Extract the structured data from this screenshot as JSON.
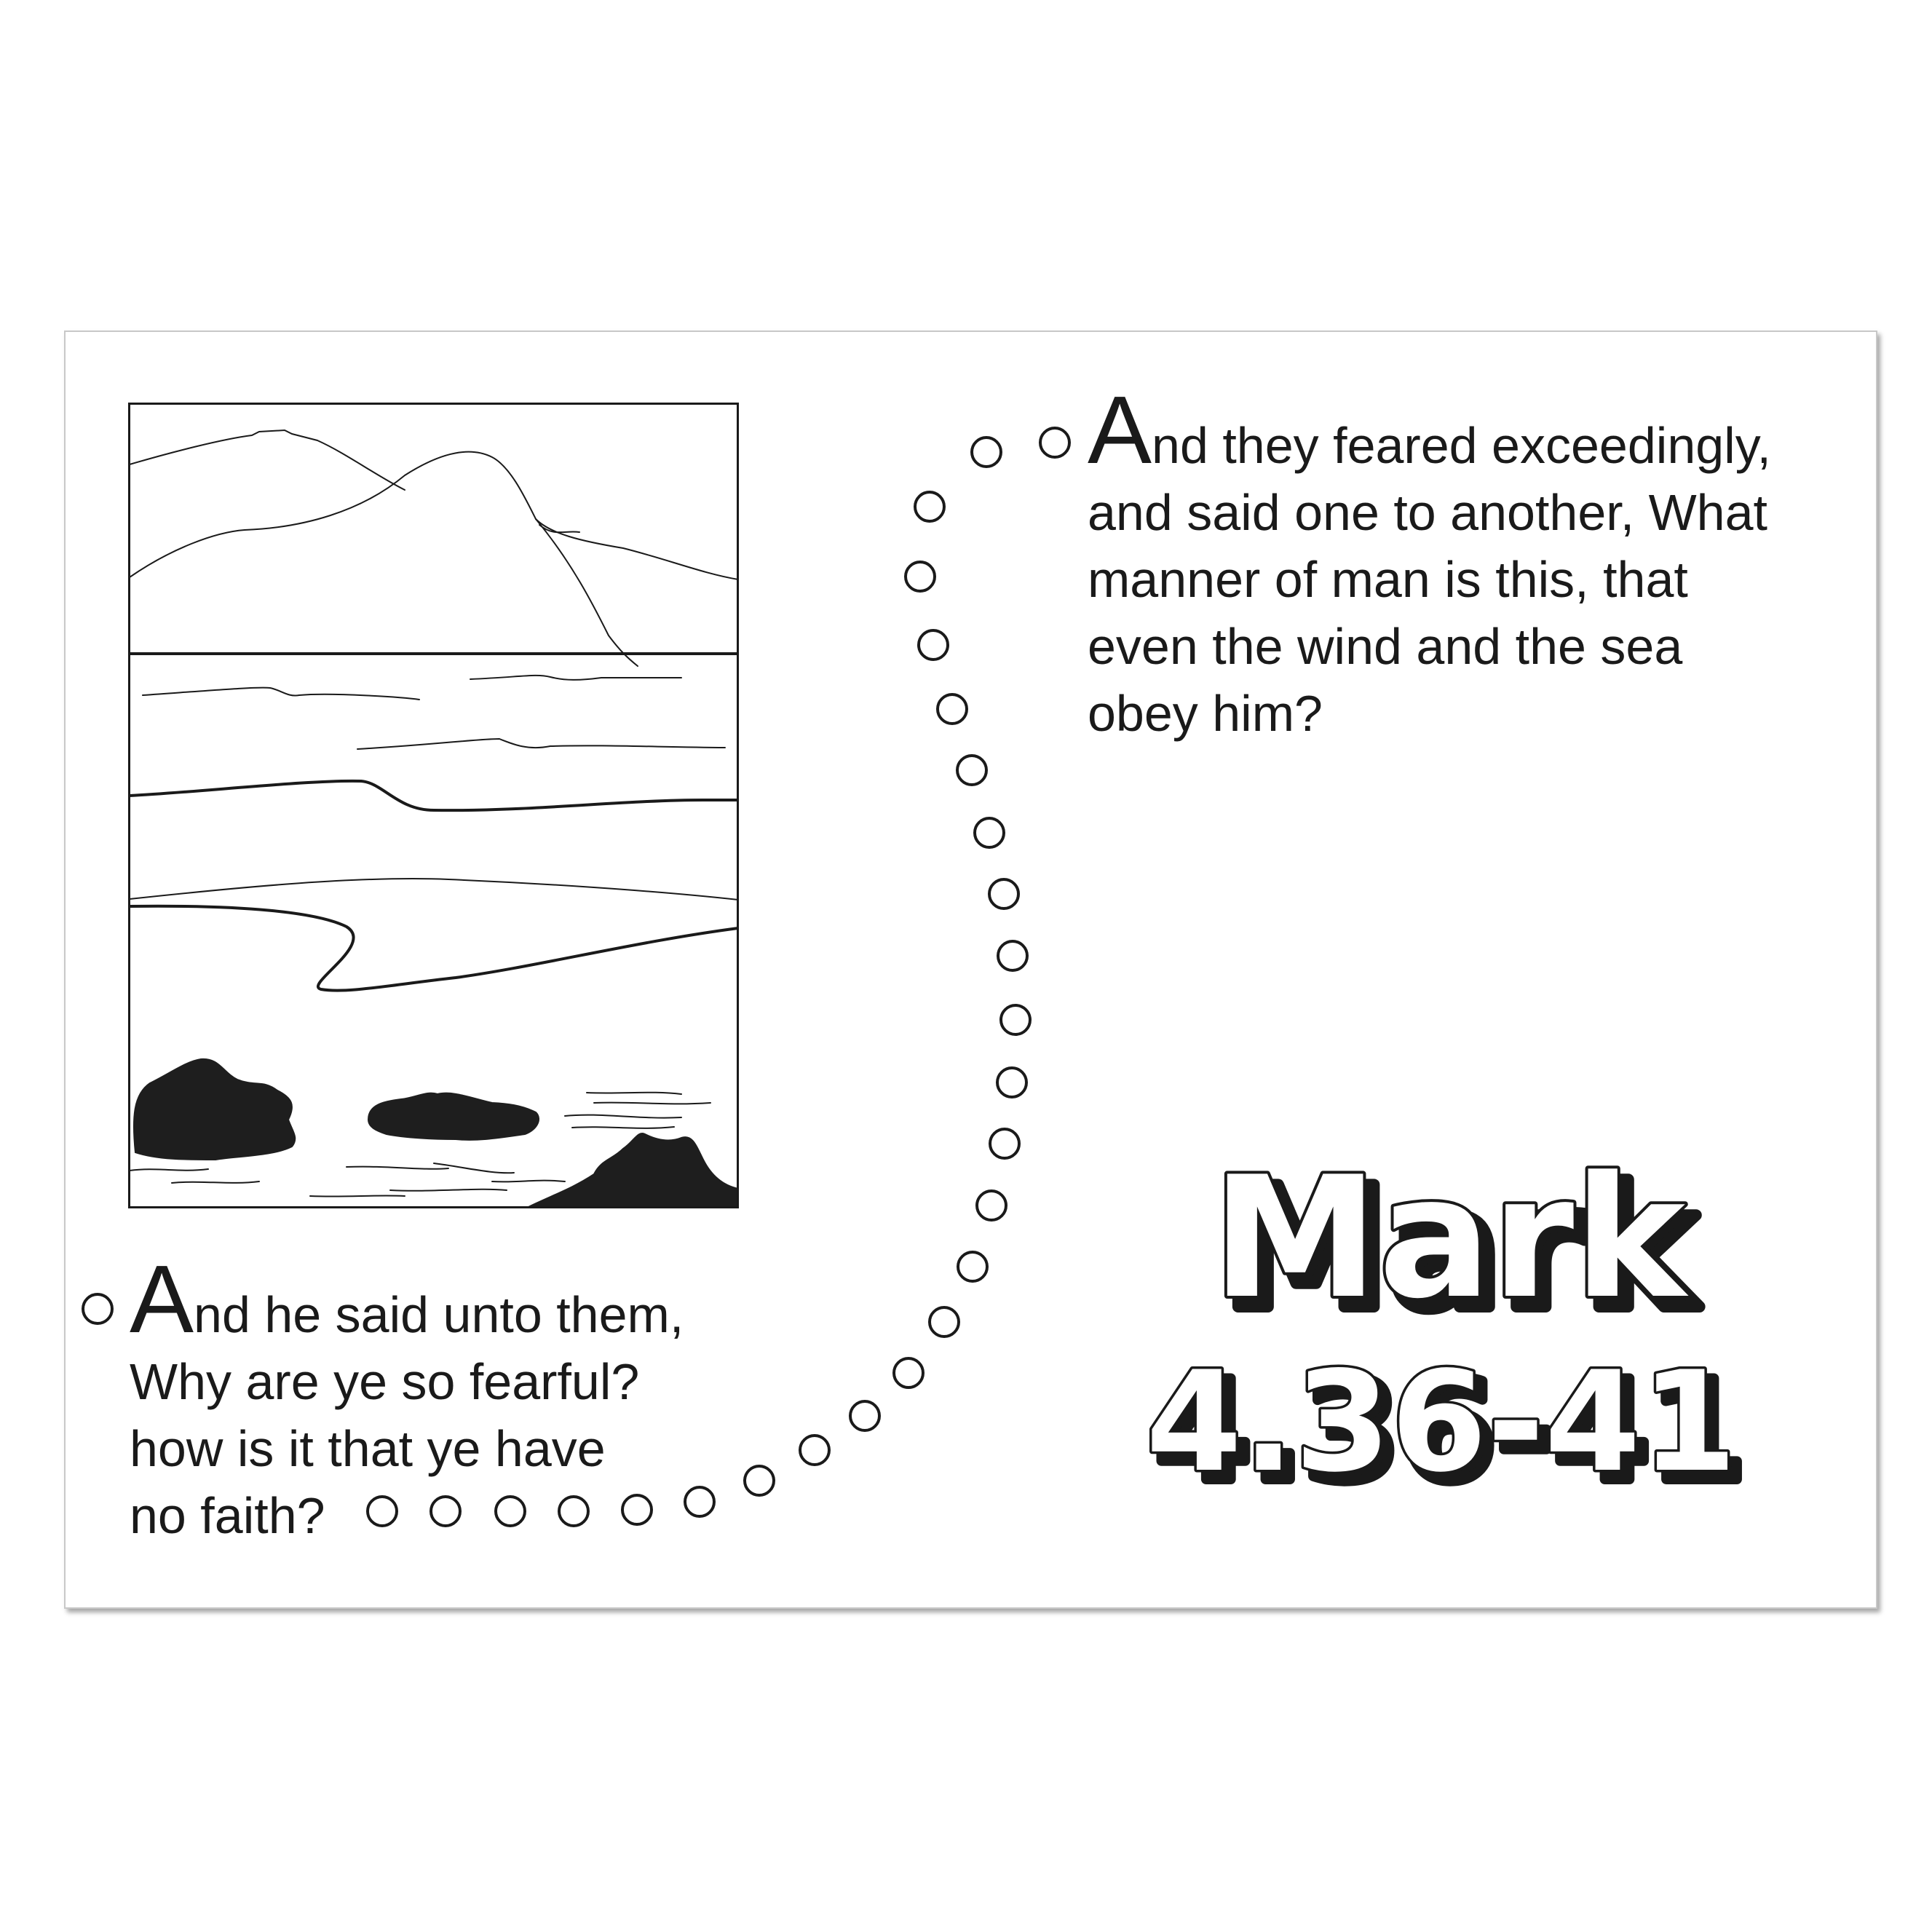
{
  "verse_top": {
    "dropcap": "A",
    "lines": [
      "nd they feared exceedingly,",
      "and said one to another, What",
      "manner of man is this, that",
      "even the wind and the sea",
      "obey him?"
    ]
  },
  "verse_bottom": {
    "dropcap": "A",
    "lines": [
      "nd he said unto them,",
      "Why are ye so fearful?",
      "how is it that ye have",
      "no faith?"
    ]
  },
  "reference": {
    "book": "Mark",
    "verses": "4.36-41"
  },
  "colors": {
    "ink": "#1a1a1a",
    "paper": "#ffffff",
    "card_border": "#c8c8c8",
    "rock_fill": "#1e1e1e"
  },
  "icons": [
    "mountain-sea-scene",
    "dot-circle-path"
  ]
}
